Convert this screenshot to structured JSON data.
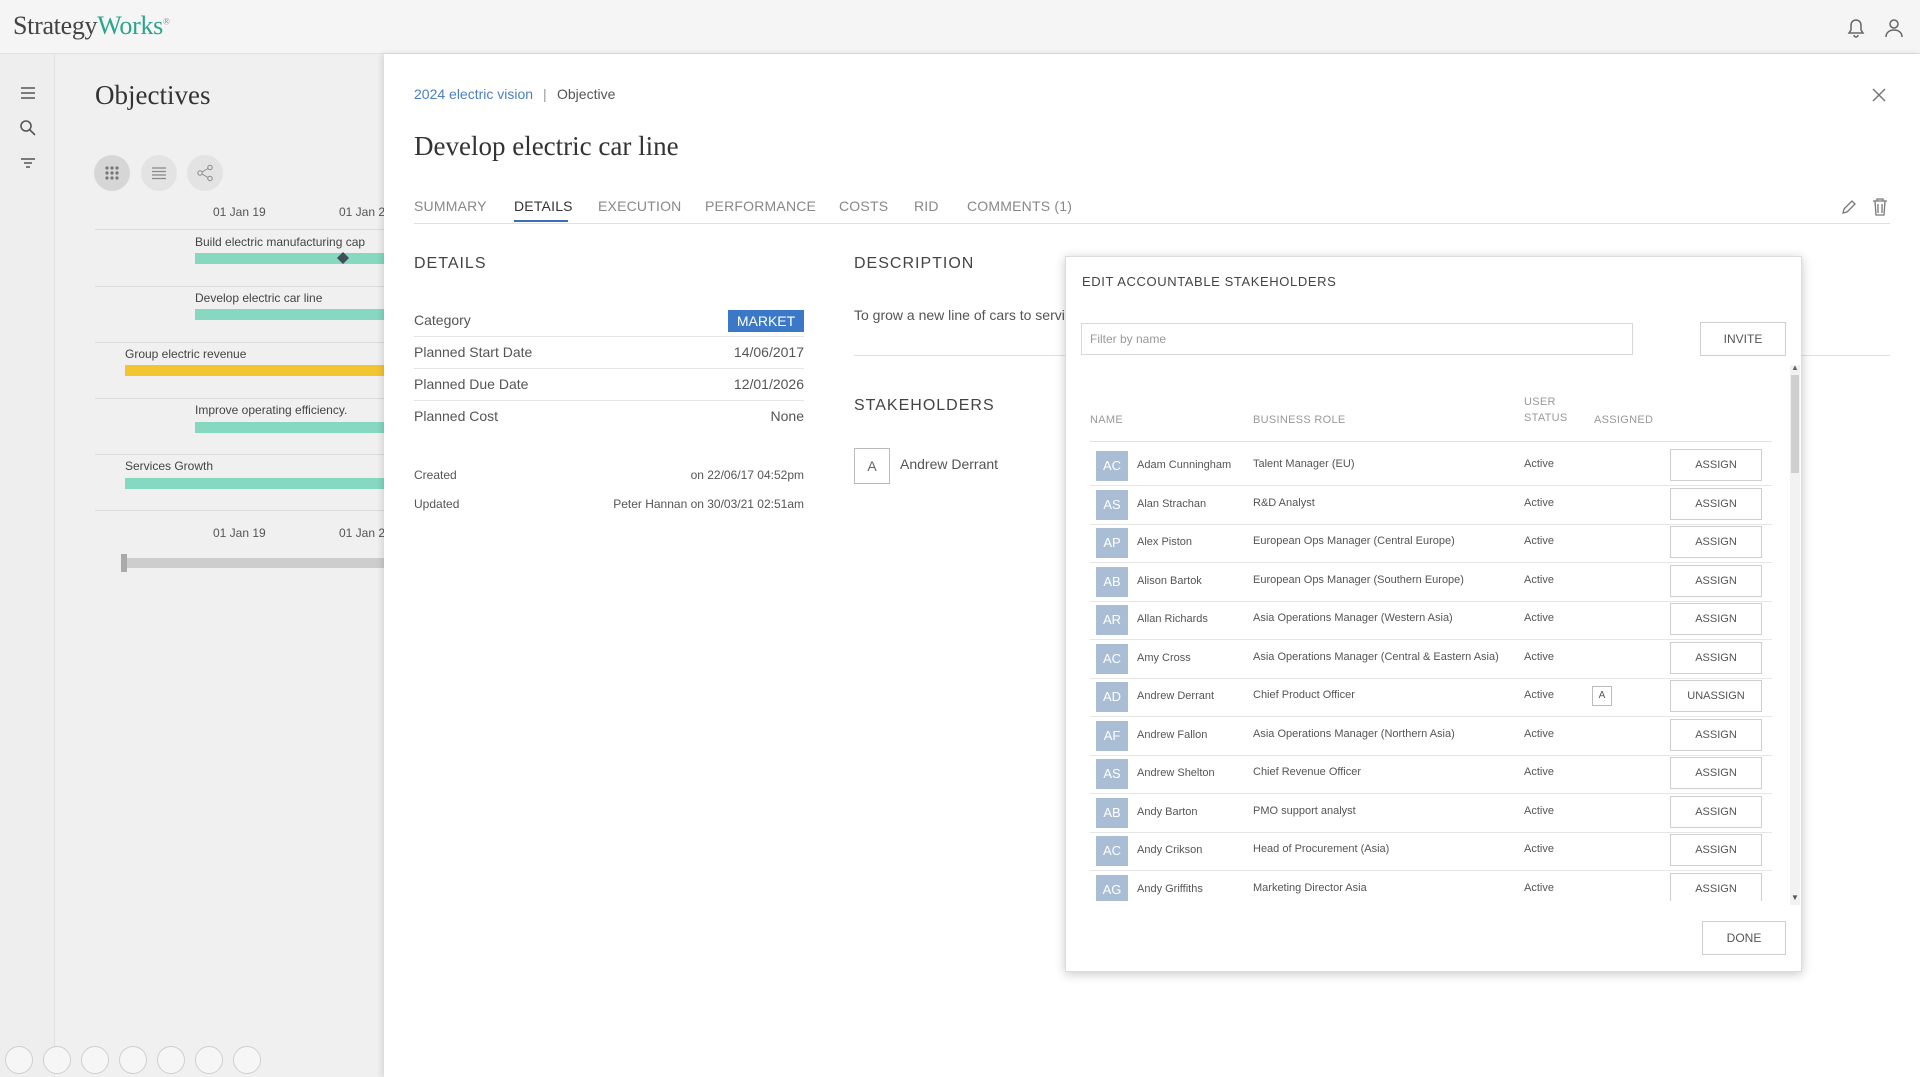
{
  "brand": {
    "part1": "Strategy",
    "part2": "Works",
    "mark": "®"
  },
  "background_page": {
    "title": "Objectives",
    "axis_labels": [
      "01 Jan 19",
      "01 Jan 2",
      "01 Jan 19",
      "01 Jan 2"
    ],
    "gantt_items": [
      {
        "label": "Build electric manufacturing cap",
        "color": "teal"
      },
      {
        "label": "Develop electric car line",
        "color": "teal"
      },
      {
        "label": "Group electric revenue",
        "color": "yellow"
      },
      {
        "label": "Improve operating efficiency.",
        "color": "teal"
      },
      {
        "label": "Services Growth",
        "color": "teal"
      }
    ]
  },
  "breadcrumb": {
    "parent": "2024 electric vision",
    "separator": "|",
    "current": "Objective"
  },
  "objective_title": "Develop electric car line",
  "tabs": [
    "SUMMARY",
    "DETAILS",
    "EXECUTION",
    "PERFORMANCE",
    "COSTS",
    "RID",
    "COMMENTS (1)"
  ],
  "active_tab": "DETAILS",
  "details": {
    "heading": "DETAILS",
    "category_label": "Category",
    "category_value": "MARKET",
    "planned_start_label": "Planned Start Date",
    "planned_start_value": "14/06/2017",
    "planned_due_label": "Planned Due Date",
    "planned_due_value": "12/01/2026",
    "planned_cost_label": "Planned Cost",
    "planned_cost_value": "None",
    "created_label": "Created",
    "created_value": "on 22/06/17 04:52pm",
    "updated_label": "Updated",
    "updated_value": "Peter Hannan on 30/03/21 02:51am"
  },
  "description": {
    "heading": "DESCRIPTION",
    "text": "To grow a new line of cars to servi"
  },
  "stakeholders": {
    "heading": "STAKEHOLDERS",
    "initial": "A",
    "name": "Andrew Derrant"
  },
  "modal": {
    "title": "EDIT ACCOUNTABLE STAKEHOLDERS",
    "filter_placeholder": "Filter by name",
    "invite_label": "INVITE",
    "columns": {
      "name": "NAME",
      "role": "BUSINESS ROLE",
      "status_line1": "USER",
      "status_line2": "STATUS",
      "assigned": "ASSIGNED"
    },
    "rows": [
      {
        "initials": "AC",
        "name": "Adam Cunningham",
        "role": "Talent Manager (EU)",
        "status": "Active",
        "assigned": "",
        "action": "ASSIGN"
      },
      {
        "initials": "AS",
        "name": "Alan Strachan",
        "role": "R&D Analyst",
        "status": "Active",
        "assigned": "",
        "action": "ASSIGN"
      },
      {
        "initials": "AP",
        "name": "Alex Piston",
        "role": "European Ops Manager (Central Europe)",
        "status": "Active",
        "assigned": "",
        "action": "ASSIGN"
      },
      {
        "initials": "AB",
        "name": "Alison Bartok",
        "role": "European Ops Manager (Southern Europe)",
        "status": "Active",
        "assigned": "",
        "action": "ASSIGN"
      },
      {
        "initials": "AR",
        "name": "Allan Richards",
        "role": "Asia Operations Manager (Western Asia)",
        "status": "Active",
        "assigned": "",
        "action": "ASSIGN"
      },
      {
        "initials": "AC",
        "name": "Amy Cross",
        "role": "Asia Operations Manager (Central & Eastern Asia)",
        "status": "Active",
        "assigned": "",
        "action": "ASSIGN"
      },
      {
        "initials": "AD",
        "name": "Andrew Derrant",
        "role": "Chief Product Officer",
        "status": "Active",
        "assigned": "A",
        "action": "UNASSIGN"
      },
      {
        "initials": "AF",
        "name": "Andrew Fallon",
        "role": "Asia Operations Manager (Northern Asia)",
        "status": "Active",
        "assigned": "",
        "action": "ASSIGN"
      },
      {
        "initials": "AS",
        "name": "Andrew Shelton",
        "role": "Chief Revenue Officer",
        "status": "Active",
        "assigned": "",
        "action": "ASSIGN"
      },
      {
        "initials": "AB",
        "name": "Andy Barton",
        "role": "PMO support analyst",
        "status": "Active",
        "assigned": "",
        "action": "ASSIGN"
      },
      {
        "initials": "AC",
        "name": "Andy Crikson",
        "role": "Head of Procurement (Asia)",
        "status": "Active",
        "assigned": "",
        "action": "ASSIGN"
      },
      {
        "initials": "AG",
        "name": "Andy Griffiths",
        "role": "Marketing Director Asia",
        "status": "Active",
        "assigned": "",
        "action": "ASSIGN"
      }
    ],
    "done_label": "DONE"
  },
  "colors": {
    "accent": "#3b79c8",
    "brand_green": "#2aa58c",
    "gantt_teal": "#86d8c0",
    "gantt_yellow": "#f3c531",
    "avatar": "#a9bdd5"
  },
  "icons": [
    "bell-icon",
    "user-icon",
    "menu-icon",
    "search-icon",
    "filter-icon",
    "grid-icon",
    "list-icon",
    "share-icon",
    "close-icon",
    "edit-icon",
    "trash-icon"
  ]
}
